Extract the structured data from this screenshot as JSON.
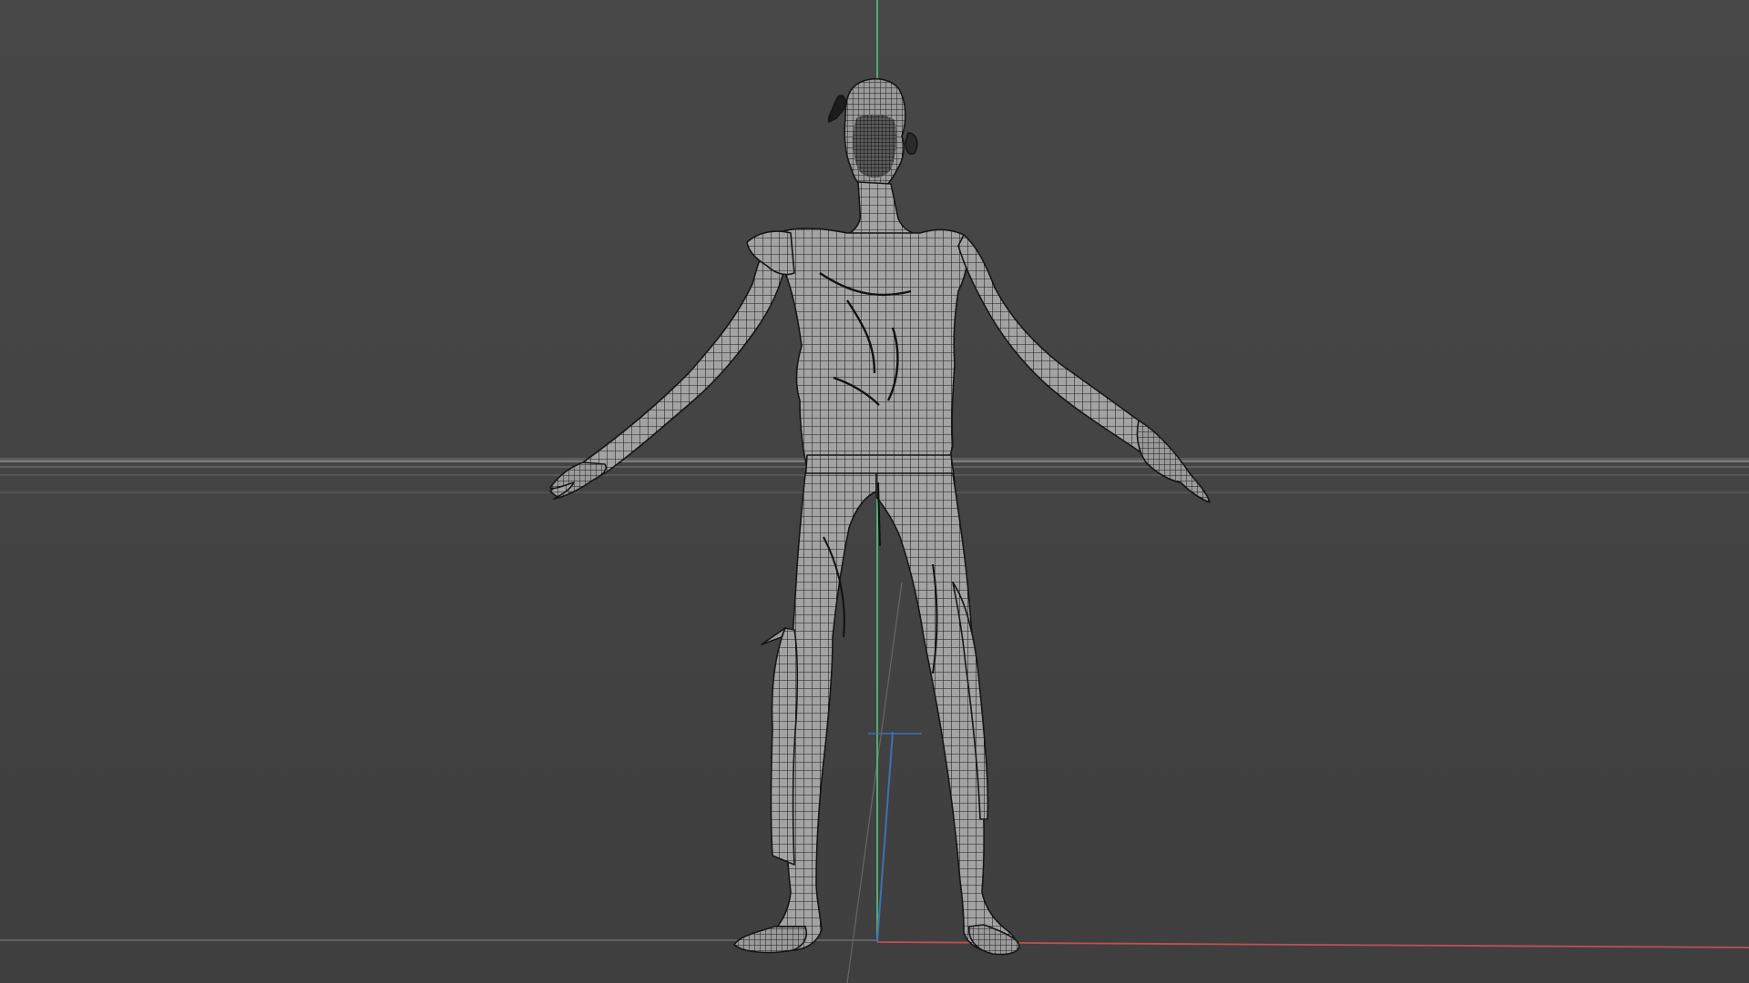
{
  "viewport": {
    "mode": "wireframe",
    "view": "front",
    "colors": {
      "background": "#444444",
      "horizon": "#9a9a9a",
      "axis_x": "#c05050",
      "axis_y": "#4fae6a",
      "axis_z": "#3f6fb5",
      "wire": "#1a1a1a",
      "mesh_fill": "#9c9c9c"
    }
  },
  "scene": {
    "object": "humanoid-character-mesh",
    "pose": "A-pose"
  }
}
